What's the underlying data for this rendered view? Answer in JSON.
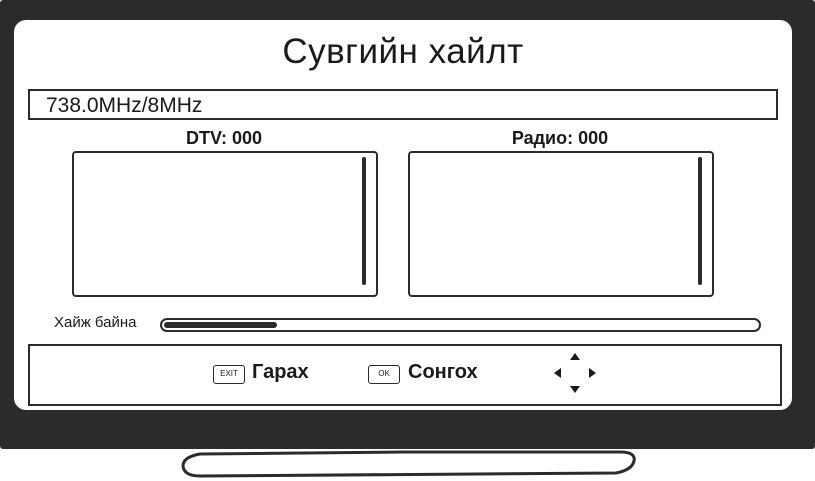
{
  "screen": {
    "title": "Сувгийн хайлт",
    "frequency": "738.0MHz/8MHz",
    "dtv_label": "DTV: 000",
    "radio_label": "Радио: 000",
    "progress_label": "Хайж байна",
    "progress_fraction": 0.19
  },
  "help_bar": {
    "exit_key": "EXIT",
    "exit_label": "Гарах",
    "ok_key": "OK",
    "ok_label": "Сонгох",
    "nav_icon": "arrows-icon"
  },
  "colors": {
    "frame": "#2b2b2b",
    "screen": "#ffffff",
    "text": "#1a1a1a"
  }
}
